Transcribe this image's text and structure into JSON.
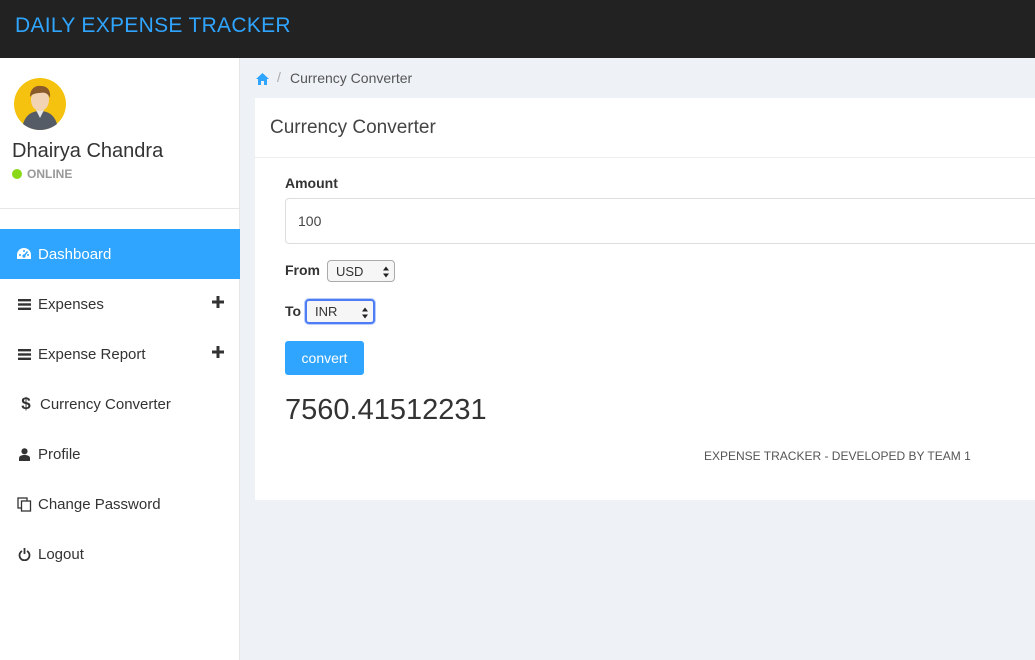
{
  "header": {
    "brand": "DAILY EXPENSE TRACKER"
  },
  "user": {
    "name": "Dhairya Chandra",
    "status": "ONLINE"
  },
  "sidebar": {
    "items": [
      {
        "label": "Dashboard",
        "icon": "dashboard-icon",
        "active": true
      },
      {
        "label": "Expenses",
        "icon": "list-icon",
        "expandable": true
      },
      {
        "label": "Expense Report",
        "icon": "list-icon",
        "expandable": true
      },
      {
        "label": "Currency Converter",
        "icon": "dollar-icon"
      },
      {
        "label": "Profile",
        "icon": "user-icon"
      },
      {
        "label": "Change Password",
        "icon": "copy-icon"
      },
      {
        "label": "Logout",
        "icon": "power-icon"
      }
    ]
  },
  "breadcrumb": {
    "home_icon": "home-icon",
    "current": "Currency Converter"
  },
  "converter": {
    "title": "Currency Converter",
    "amount_label": "Amount",
    "amount_value": "100",
    "from_label": "From",
    "from_value": "USD",
    "to_label": "To",
    "to_value": "INR",
    "button_label": "convert",
    "result": "7560.41512231"
  },
  "footer": {
    "text": "EXPENSE TRACKER - DEVELOPED BY TEAM 1"
  },
  "colors": {
    "accent": "#30a5ff",
    "topbar": "#222222",
    "online": "#8ad919"
  }
}
